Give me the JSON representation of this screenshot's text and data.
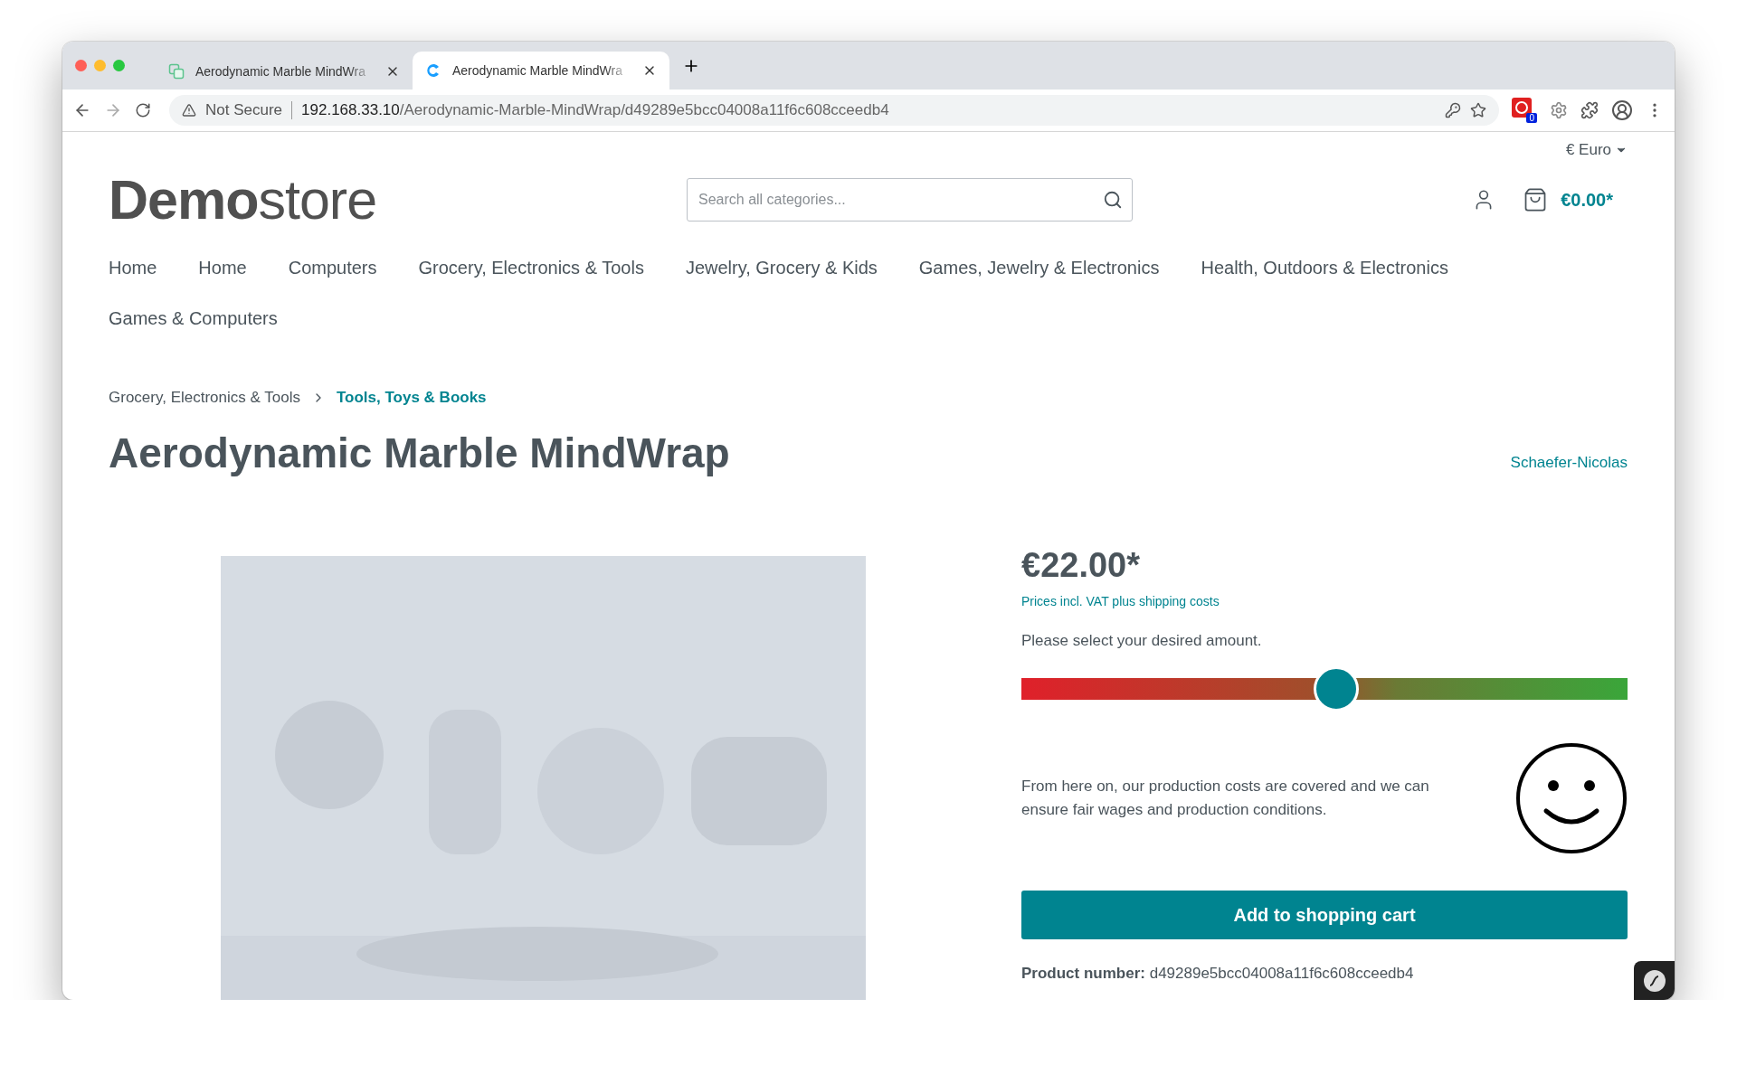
{
  "browser": {
    "tabs": [
      {
        "title": "Aerodynamic Marble MindWra",
        "selected": false
      },
      {
        "title": "Aerodynamic Marble MindWra",
        "selected": true
      }
    ],
    "security": "Not Secure",
    "url_host": "192.168.33.10",
    "url_path": "/Aerodynamic-Marble-MindWrap/d49289e5bcc04008a11f6c608cceedb4",
    "extension_badge": "0"
  },
  "shop": {
    "currency": "€ Euro",
    "logo_bold": "Demo",
    "logo_light": "store",
    "search_placeholder": "Search all categories...",
    "cart_total": "€0.00*",
    "nav": [
      "Home",
      "Home",
      "Computers",
      "Grocery, Electronics & Tools",
      "Jewelry, Grocery & Kids",
      "Games, Jewelry & Electronics",
      "Health, Outdoors & Electronics",
      "Games & Computers"
    ],
    "breadcrumb": [
      {
        "label": "Grocery, Electronics & Tools",
        "current": false
      },
      {
        "label": "Tools, Toys & Books",
        "current": true
      }
    ],
    "title": "Aerodynamic Marble MindWrap",
    "manufacturer": "Schaefer-Nicolas",
    "price": "€22.00*",
    "tax_note": "Prices incl. VAT plus shipping costs",
    "amount_prompt": "Please select your desired amount.",
    "amount": {
      "level": 0.52
    },
    "amount_message": "From here on, our production costs are covered and we can ensure fair wages and production conditions.",
    "add_to_cart": "Add to shopping cart",
    "product_number_label": "Product number:",
    "product_number": "d49289e5bcc04008a11f6c608cceedb4"
  }
}
